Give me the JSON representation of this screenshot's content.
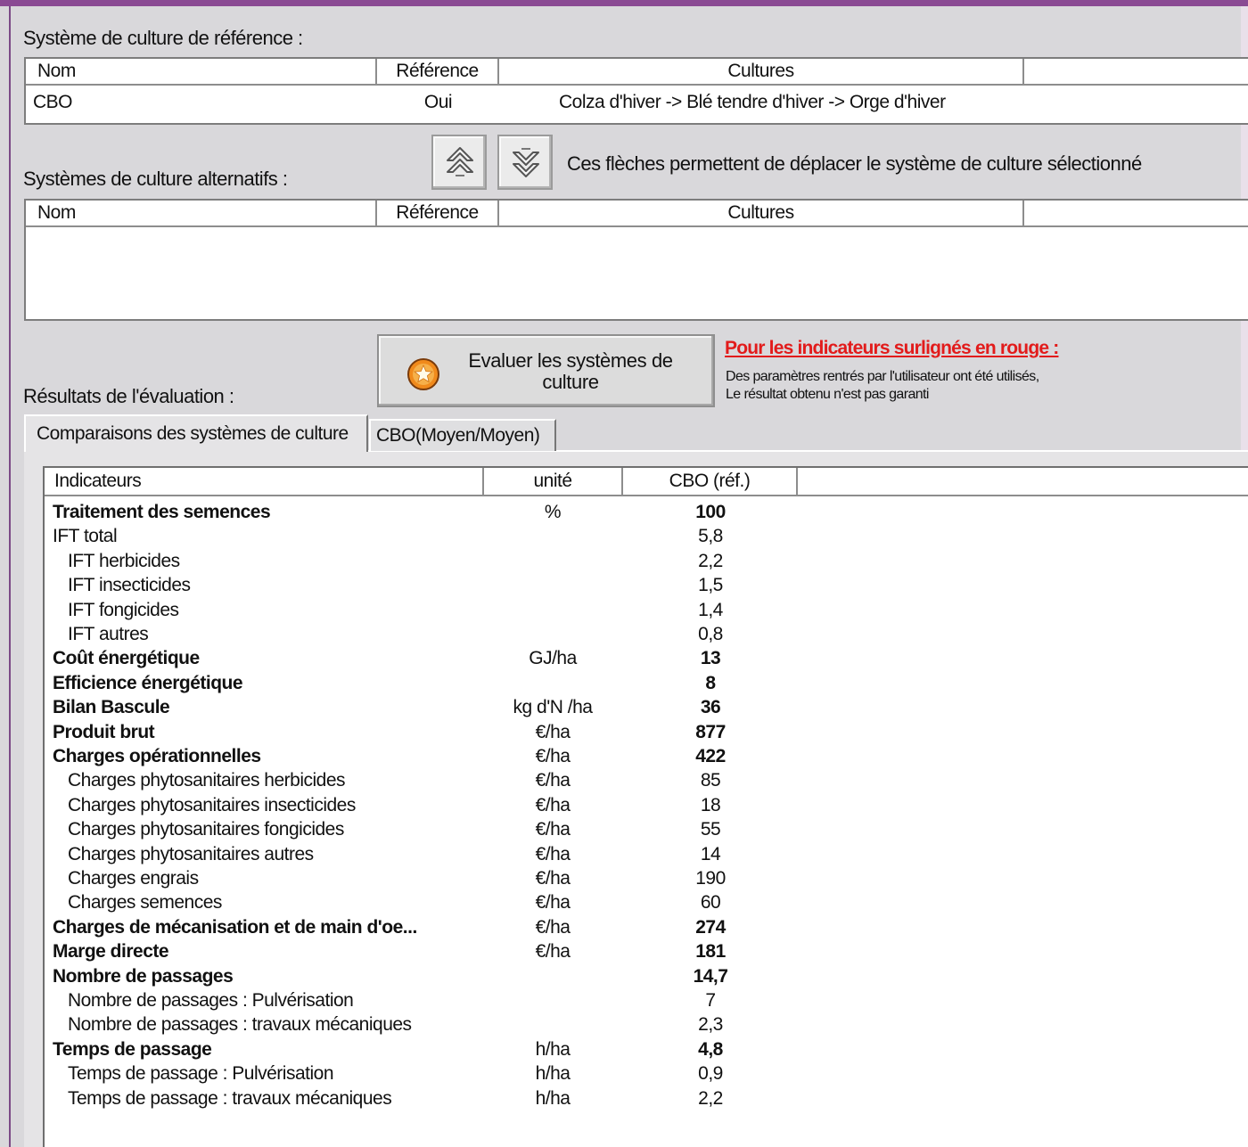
{
  "reference": {
    "title": "Système de culture de référence :",
    "columns": [
      "Nom",
      "Référence",
      "Cultures"
    ],
    "row": {
      "nom": "CBO",
      "reference": "Oui",
      "cultures": "Colza d'hiver -> Blé tendre d'hiver -> Orge d'hiver"
    }
  },
  "alternatives": {
    "title": "Systèmes de culture alternatifs :",
    "columns": [
      "Nom",
      "Référence",
      "Cultures"
    ],
    "move_hint": "Ces flèches permettent de déplacer le système de culture sélectionné",
    "icons": {
      "up": "double-chevron-up-icon",
      "down": "double-chevron-down-icon"
    }
  },
  "evaluate": {
    "button_label": "Evaluer les systèmes de culture",
    "icon": "star-icon"
  },
  "warning": {
    "title": "Pour les indicateurs surlignés en rouge :",
    "line1": "Des paramètres rentrés par l'utilisateur ont été utilisés,",
    "line2": "Le résultat obtenu n'est pas garanti",
    "color": "#e21b1b"
  },
  "results": {
    "title": "Résultats de l'évaluation :",
    "tabs": [
      "Comparaisons des systèmes de culture",
      "CBO(Moyen/Moyen)"
    ],
    "columns": {
      "indicator": "Indicateurs",
      "unit": "unité",
      "value": "CBO (réf.)"
    },
    "rows": [
      {
        "label": "Traitement des semences",
        "unit": "%",
        "value": "100",
        "bold": true,
        "level": 0
      },
      {
        "label": "IFT total",
        "unit": "",
        "value": "5,8",
        "bold": false,
        "level": 0
      },
      {
        "label": "IFT herbicides",
        "unit": "",
        "value": "2,2",
        "bold": false,
        "level": 1
      },
      {
        "label": "IFT insecticides",
        "unit": "",
        "value": "1,5",
        "bold": false,
        "level": 1
      },
      {
        "label": "IFT fongicides",
        "unit": "",
        "value": "1,4",
        "bold": false,
        "level": 1
      },
      {
        "label": "IFT autres",
        "unit": "",
        "value": "0,8",
        "bold": false,
        "level": 1
      },
      {
        "label": "Coût énergétique",
        "unit": "GJ/ha",
        "value": "13",
        "bold": true,
        "level": 0
      },
      {
        "label": "Efficience énergétique",
        "unit": "",
        "value": "8",
        "bold": true,
        "level": 0
      },
      {
        "label": "Bilan Bascule",
        "unit": "kg d'N /ha",
        "value": "36",
        "bold": true,
        "level": 0
      },
      {
        "label": "Produit brut",
        "unit": "€/ha",
        "value": "877",
        "bold": true,
        "level": 0
      },
      {
        "label": "Charges opérationnelles",
        "unit": "€/ha",
        "value": "422",
        "bold": true,
        "level": 0
      },
      {
        "label": "Charges phytosanitaires herbicides",
        "unit": "€/ha",
        "value": "85",
        "bold": false,
        "level": 1
      },
      {
        "label": "Charges phytosanitaires insecticides",
        "unit": "€/ha",
        "value": "18",
        "bold": false,
        "level": 1
      },
      {
        "label": "Charges phytosanitaires fongicides",
        "unit": "€/ha",
        "value": "55",
        "bold": false,
        "level": 1
      },
      {
        "label": "Charges phytosanitaires autres",
        "unit": "€/ha",
        "value": "14",
        "bold": false,
        "level": 1
      },
      {
        "label": "Charges engrais",
        "unit": "€/ha",
        "value": "190",
        "bold": false,
        "level": 1
      },
      {
        "label": "Charges semences",
        "unit": "€/ha",
        "value": "60",
        "bold": false,
        "level": 1
      },
      {
        "label": "Charges de mécanisation et de main d'oe...",
        "unit": "€/ha",
        "value": "274",
        "bold": true,
        "level": 0
      },
      {
        "label": "Marge directe",
        "unit": "€/ha",
        "value": "181",
        "bold": true,
        "level": 0
      },
      {
        "label": "Nombre de passages",
        "unit": "",
        "value": "14,7",
        "bold": true,
        "level": 0
      },
      {
        "label": "Nombre de passages : Pulvérisation",
        "unit": "",
        "value": "7",
        "bold": false,
        "level": 1
      },
      {
        "label": "Nombre de passages : travaux mécaniques",
        "unit": "",
        "value": "2,3",
        "bold": false,
        "level": 1
      },
      {
        "label": "Temps de passage",
        "unit": "h/ha",
        "value": "4,8",
        "bold": true,
        "level": 0
      },
      {
        "label": "Temps de passage : Pulvérisation",
        "unit": "h/ha",
        "value": "0,9",
        "bold": false,
        "level": 1
      },
      {
        "label": "Temps de passage : travaux mécaniques",
        "unit": "h/ha",
        "value": "2,2",
        "bold": false,
        "level": 1
      }
    ]
  }
}
